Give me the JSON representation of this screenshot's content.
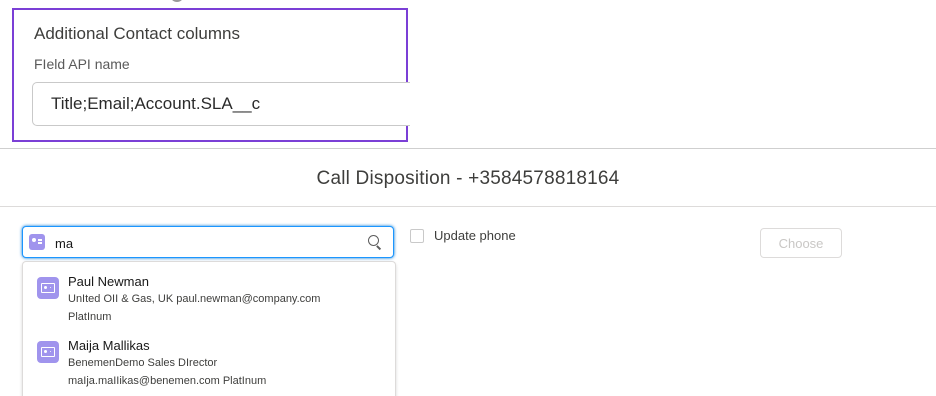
{
  "config": {
    "heading": "Additional Contact columns",
    "field_label": "FIeld API name",
    "field_value": "Title;Email;Account.SLA__c"
  },
  "modal": {
    "title": "Call Disposition - +3584578818164"
  },
  "search": {
    "value": "ma",
    "entity_icon": "contact-icon",
    "action_icon": "search-icon"
  },
  "results": [
    {
      "name": "Paul Newman",
      "line1": "UnIted OII & Gas, UK paul.newman@company.com",
      "line2": "PlatInum"
    },
    {
      "name": "Maija Mallikas",
      "line1": "BenemenDemo Sales DIrector",
      "line2": "maIja.maIIikas@benemen.com PlatInum"
    }
  ],
  "update_phone": {
    "label": "Update phone",
    "checked": false
  },
  "choose_button": {
    "label": "Choose",
    "disabled": true
  },
  "colors": {
    "accent_border": "#7b3fd6",
    "focus_blue": "#1b96ff",
    "contact_icon": "#a094ed"
  }
}
